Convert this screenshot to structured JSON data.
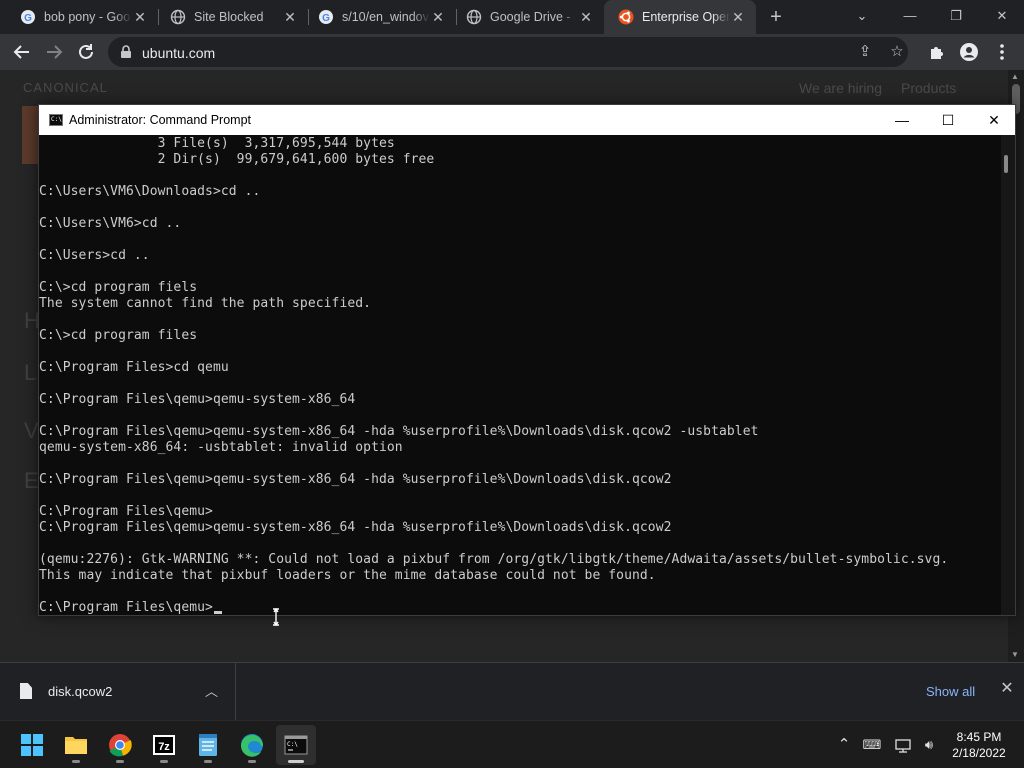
{
  "browser": {
    "tabs": [
      {
        "label": "bob pony - Goo",
        "favicon": "google-icon",
        "active": false
      },
      {
        "label": "Site Blocked",
        "favicon": "globe-icon",
        "active": false
      },
      {
        "label": "s/10/en_windov",
        "favicon": "google-icon",
        "active": false
      },
      {
        "label": "Google Drive - ",
        "favicon": "globe-icon",
        "active": false
      },
      {
        "label": "Enterprise Oper",
        "favicon": "ubuntu-icon",
        "active": true
      }
    ],
    "new_tab_symbol": "+",
    "url": "ubuntu.com"
  },
  "page": {
    "brand": "CANONICAL",
    "nav": [
      "We are hiring",
      "Products"
    ],
    "accent_color": "#e95420"
  },
  "cmd": {
    "title": "Administrator: Command Prompt",
    "lines": [
      "               3 File(s)  3,317,695,544 bytes",
      "               2 Dir(s)  99,679,641,600 bytes free",
      "",
      "C:\\Users\\VM6\\Downloads>cd ..",
      "",
      "C:\\Users\\VM6>cd ..",
      "",
      "C:\\Users>cd ..",
      "",
      "C:\\>cd program fiels",
      "The system cannot find the path specified.",
      "",
      "C:\\>cd program files",
      "",
      "C:\\Program Files>cd qemu",
      "",
      "C:\\Program Files\\qemu>qemu-system-x86_64",
      "",
      "C:\\Program Files\\qemu>qemu-system-x86_64 -hda %userprofile%\\Downloads\\disk.qcow2 -usbtablet",
      "qemu-system-x86_64: -usbtablet: invalid option",
      "",
      "C:\\Program Files\\qemu>qemu-system-x86_64 -hda %userprofile%\\Downloads\\disk.qcow2",
      "",
      "C:\\Program Files\\qemu>",
      "C:\\Program Files\\qemu>qemu-system-x86_64 -hda %userprofile%\\Downloads\\disk.qcow2",
      "",
      "(qemu:2276): Gtk-WARNING **: Could not load a pixbuf from /org/gtk/libgtk/theme/Adwaita/assets/bullet-symbolic.svg.",
      "This may indicate that pixbuf loaders or the mime database could not be found.",
      ""
    ],
    "prompt": "C:\\Program Files\\qemu>"
  },
  "downloads": {
    "file": "disk.qcow2",
    "show_all": "Show all"
  },
  "taskbar": {
    "apps": [
      "windows-start-icon",
      "file-explorer-icon",
      "chrome-icon",
      "7zip-icon",
      "notepad-icon",
      "edge-icon",
      "command-prompt-icon"
    ],
    "time": "8:45 PM",
    "date": "2/18/2022"
  }
}
